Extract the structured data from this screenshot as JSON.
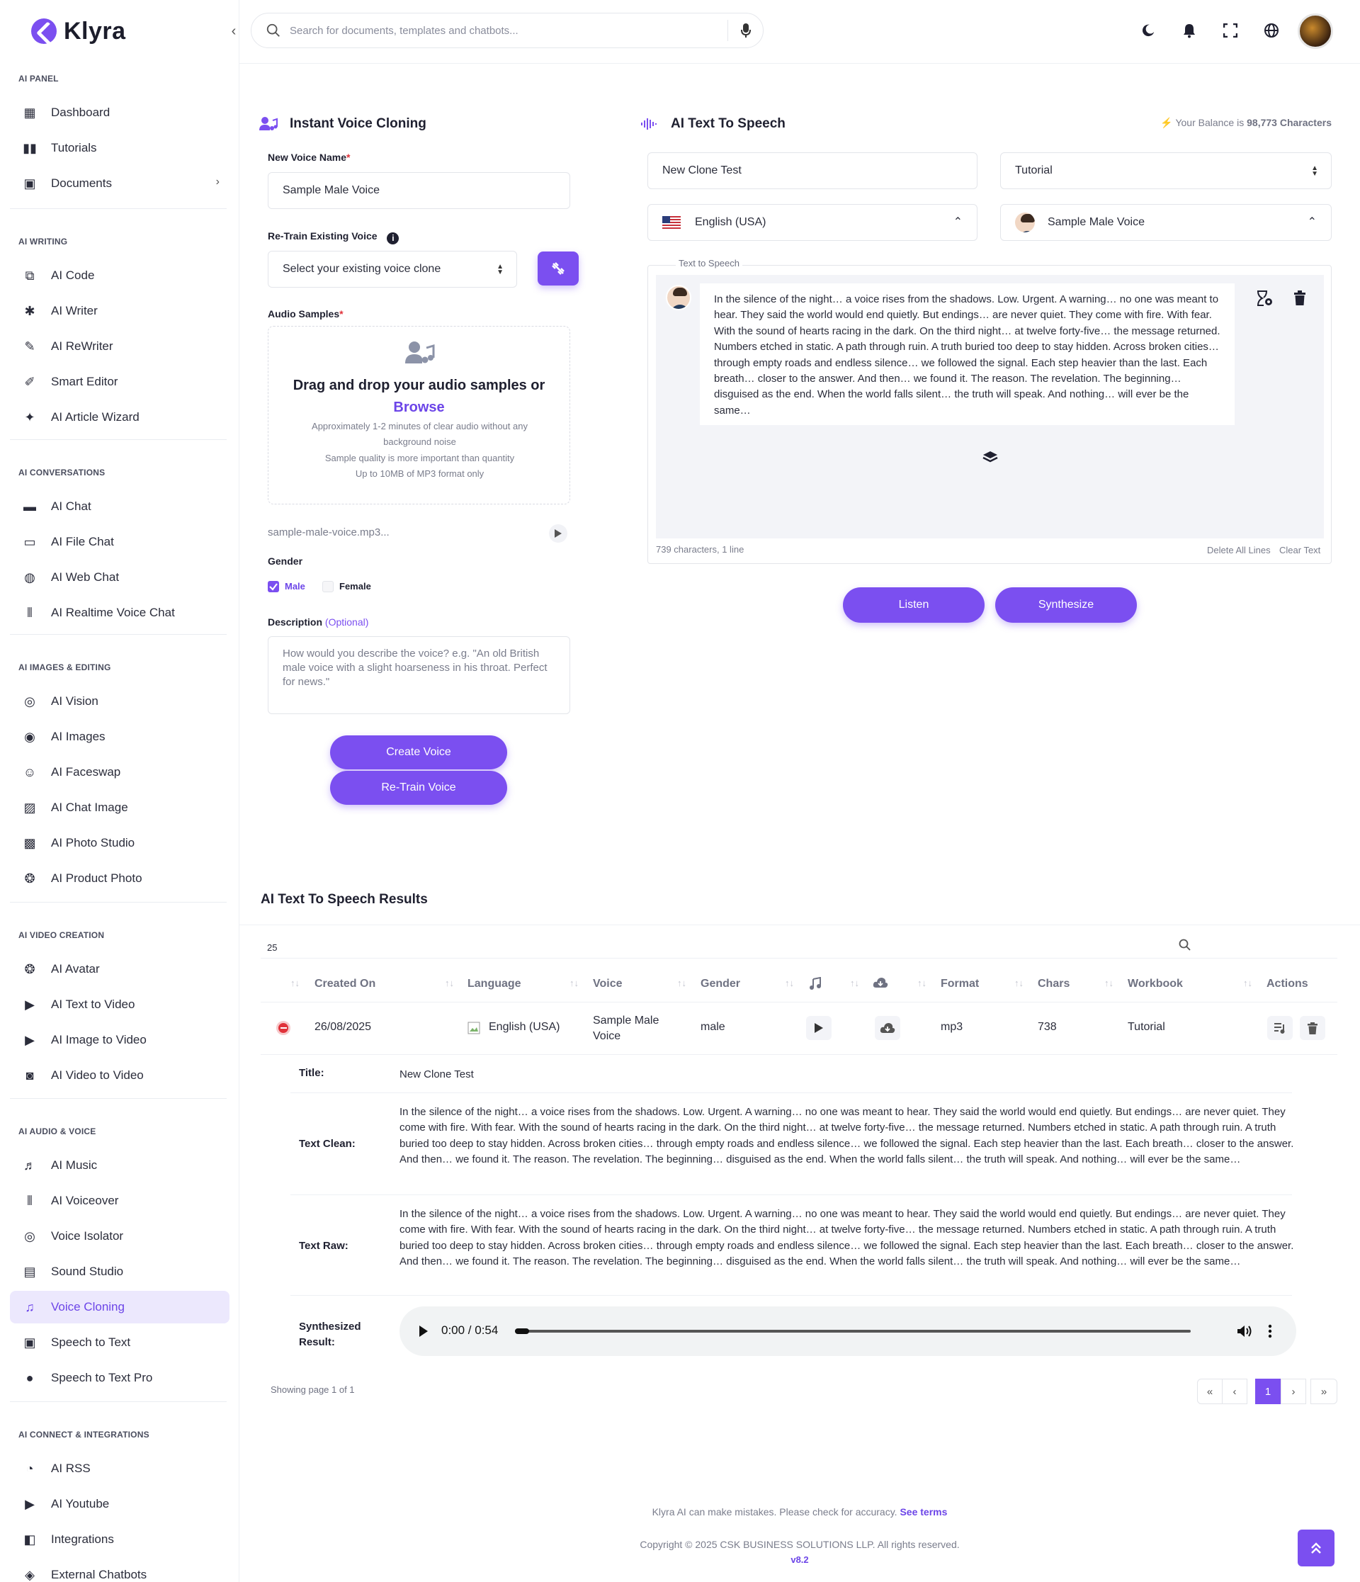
{
  "app": {
    "name": "Klyra"
  },
  "sidebar": {
    "sections": [
      {
        "title": "AI PANEL",
        "items": [
          "Dashboard",
          "Tutorials",
          "Documents"
        ]
      },
      {
        "title": "AI WRITING",
        "items": [
          "AI Code",
          "AI Writer",
          "AI ReWriter",
          "Smart Editor",
          "AI Article Wizard"
        ]
      },
      {
        "title": "AI CONVERSATIONS",
        "items": [
          "AI Chat",
          "AI File Chat",
          "AI Web Chat",
          "AI Realtime Voice Chat"
        ]
      },
      {
        "title": "AI IMAGES & EDITING",
        "items": [
          "AI Vision",
          "AI Images",
          "AI Faceswap",
          "AI Chat Image",
          "AI Photo Studio",
          "AI Product Photo"
        ]
      },
      {
        "title": "AI VIDEO CREATION",
        "items": [
          "AI Avatar",
          "AI Text to Video",
          "AI Image to Video",
          "AI Video to Video"
        ]
      },
      {
        "title": "AI AUDIO & VOICE",
        "items": [
          "AI Music",
          "AI Voiceover",
          "Voice Isolator",
          "Sound Studio",
          "Voice Cloning",
          "Speech to Text",
          "Speech to Text Pro"
        ]
      },
      {
        "title": "AI CONNECT & INTEGRATIONS",
        "items": [
          "AI RSS",
          "AI Youtube",
          "Integrations",
          "External Chatbots"
        ]
      }
    ],
    "active_item": "Voice Cloning"
  },
  "header": {
    "search_placeholder": "Search for documents, templates and chatbots..."
  },
  "cloning": {
    "title": "Instant Voice Cloning",
    "name_label": "New Voice Name",
    "name_value": "Sample Male Voice",
    "retrain_label": "Re-Train Existing Voice",
    "retrain_select": "Select your existing voice clone",
    "samples_label": "Audio Samples",
    "dz_title": "Drag and drop your audio samples or",
    "dz_browse": "Browse",
    "dz_note1": "Approximately 1-2 minutes of clear audio without any",
    "dz_note2": "background noise",
    "dz_note3": "Sample quality is more important than quantity",
    "dz_note4": "Up to 10MB of MP3 format only",
    "file_name": "sample-male-voice.mp3...",
    "gender_label": "Gender",
    "gender_male": "Male",
    "gender_female": "Female",
    "desc_label": "Description",
    "desc_optional": "(Optional)",
    "desc_placeholder": "How would you describe the voice? e.g. \"An old British male voice with a slight hoarseness in his throat. Perfect for news.\"",
    "create_btn": "Create Voice",
    "retrain_btn": "Re-Train Voice"
  },
  "tts": {
    "title": "AI Text To Speech",
    "balance_prefix": "Your Balance is",
    "balance_value": "98,773 Characters",
    "title_input": "New Clone Test",
    "workbook_select": "Tutorial",
    "language_select": "English (USA)",
    "voice_select": "Sample Male Voice",
    "box_legend": "Text to Speech",
    "text": "In the silence of the night… a voice rises from the shadows. Low. Urgent. A warning… no one was meant to hear. They said the world would end quietly. But endings… are never quiet. They come with fire. With fear. With the sound of hearts racing in the dark. On the third night… at twelve forty-five… the message returned. Numbers etched in static. A path through ruin. A truth buried too deep to stay hidden. Across broken cities… through empty roads and endless silence… we followed the signal. Each step heavier than the last. Each breath… closer to the answer. And then… we found it. The reason. The revelation. The beginning… disguised as the end. When the world falls silent… the truth will speak. And nothing… will ever be the same…",
    "char_count": "739 characters, 1 line",
    "delete_lines": "Delete All Lines",
    "clear_text": "Clear Text",
    "listen_btn": "Listen",
    "synth_btn": "Synthesize"
  },
  "results": {
    "title": "AI Text To Speech Results",
    "page_size": "25",
    "columns": [
      "Created On",
      "Language",
      "Voice",
      "Gender",
      "Format",
      "Chars",
      "Workbook",
      "Actions"
    ],
    "row": {
      "created": "26/08/2025",
      "language": "English (USA)",
      "voice": "Sample Male Voice",
      "gender": "male",
      "format": "mp3",
      "chars": "738",
      "workbook": "Tutorial"
    },
    "detail": {
      "title_label": "Title:",
      "title_value": "New Clone Test",
      "clean_label": "Text Clean:",
      "raw_label": "Text Raw:",
      "text": "In the silence of the night… a voice rises from the shadows. Low. Urgent. A warning… no one was meant to hear. They said the world would end quietly. But endings… are never quiet. They come with fire. With fear. With the sound of hearts racing in the dark. On the third night… at twelve forty-five… the message returned. Numbers etched in static. A path through ruin. A truth buried too deep to stay hidden. Across broken cities… through empty roads and endless silence… we followed the signal. Each step heavier than the last. Each breath… closer to the answer. And then… we found it. The reason. The revelation. The beginning… disguised as the end. When the world falls silent… the truth will speak. And nothing… will ever be the same…",
      "synth_label1": "Synthesized",
      "synth_label2": "Result:",
      "audio_time": "0:00 / 0:54"
    },
    "showing": "Showing page 1 of 1",
    "current_page": "1"
  },
  "footer": {
    "disclaimer": "Klyra AI can make mistakes. Please check for accuracy.",
    "terms": "See terms",
    "copyright": "Copyright © 2025 CSK BUSINESS SOLUTIONS LLP. All rights reserved.",
    "version": "v8.2"
  },
  "colors": {
    "accent": "#7b4ff0",
    "active_bg": "#ece8fd"
  }
}
